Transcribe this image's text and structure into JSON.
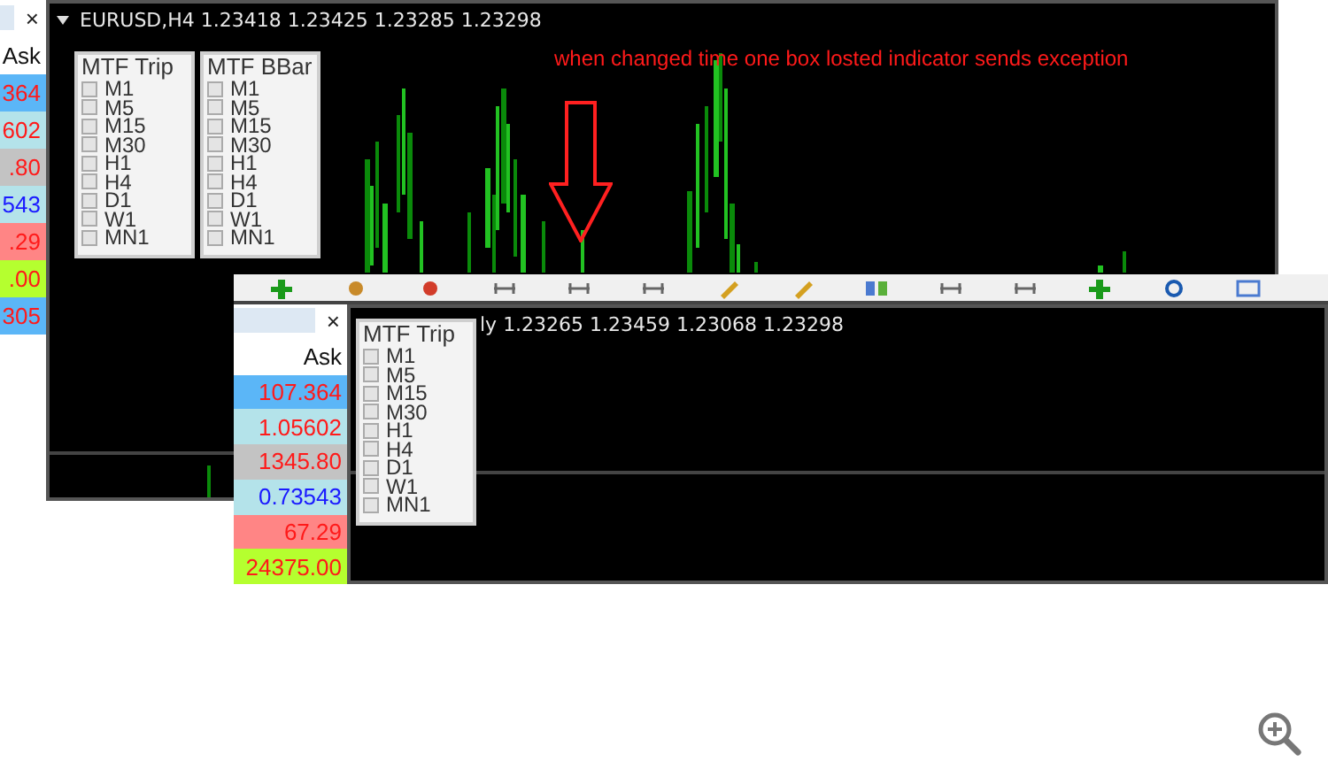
{
  "screenshots": [
    {
      "market_watch": {
        "close": "×",
        "column": "Ask",
        "rows": [
          {
            "ask": "364",
            "color": "#5bb6f7",
            "rising": false
          },
          {
            "ask": "602",
            "color": "#b4e3ea",
            "rising": false
          },
          {
            "ask": ".80",
            "color": "#c3c3c3",
            "rising": false
          },
          {
            "ask": "543",
            "color": "#b4e3ea",
            "rising": true
          },
          {
            "ask": ".29",
            "color": "#ff8585",
            "rising": false
          },
          {
            "ask": ".00",
            "color": "#b5ff2f",
            "rising": false
          },
          {
            "ask": "305",
            "color": "#5bb6f7",
            "rising": false
          }
        ]
      },
      "chart": {
        "title": "EURUSD,H4  1.23418 1.23425 1.23285 1.23298",
        "panels": [
          {
            "title": "MTF Trip",
            "options": [
              {
                "label": "M1",
                "checked": false
              },
              {
                "label": "M5",
                "checked": false
              },
              {
                "label": "M15",
                "checked": false
              },
              {
                "label": "M30",
                "checked": false
              },
              {
                "label": "H1",
                "checked": false
              },
              {
                "label": "H4",
                "checked": false
              },
              {
                "label": "D1",
                "checked": false
              },
              {
                "label": "W1",
                "checked": false
              },
              {
                "label": "MN1",
                "checked": false
              }
            ]
          },
          {
            "title": "MTF BBar",
            "options": [
              {
                "label": "M1",
                "checked": false
              },
              {
                "label": "M5",
                "checked": false
              },
              {
                "label": "M15",
                "checked": false
              },
              {
                "label": "M30",
                "checked": false
              },
              {
                "label": "H1",
                "checked": false
              },
              {
                "label": "H4",
                "checked": false
              },
              {
                "label": "D1",
                "checked": false
              },
              {
                "label": "W1",
                "checked": false
              },
              {
                "label": "MN1",
                "checked": false
              }
            ]
          }
        ]
      },
      "annotation": "when changed time one box losted indicator sends exception"
    },
    {
      "market_watch": {
        "close": "×",
        "column": "Ask",
        "rows": [
          {
            "ask": "107.364",
            "color": "#5bb6f7",
            "rising": false
          },
          {
            "ask": "1.05602",
            "color": "#b4e3ea",
            "rising": false
          },
          {
            "ask": "1345.80",
            "color": "#c3c3c3",
            "rising": false
          },
          {
            "ask": "0.73543",
            "color": "#b4e3ea",
            "rising": true
          },
          {
            "ask": "67.29",
            "color": "#ff8585",
            "rising": false
          },
          {
            "ask": "24375.00",
            "color": "#b5ff2f",
            "rising": false
          }
        ]
      },
      "chart": {
        "title": "ly  1.23265 1.23459 1.23068 1.23298",
        "panels": [
          {
            "title": "MTF Trip",
            "options": [
              {
                "label": "M1",
                "checked": false
              },
              {
                "label": "M5",
                "checked": false
              },
              {
                "label": "M15",
                "checked": false
              },
              {
                "label": "M30",
                "checked": false
              },
              {
                "label": "H1",
                "checked": false
              },
              {
                "label": "H4",
                "checked": false
              },
              {
                "label": "D1",
                "checked": false
              },
              {
                "label": "W1",
                "checked": false
              },
              {
                "label": "MN1",
                "checked": false
              }
            ]
          }
        ]
      }
    }
  ]
}
